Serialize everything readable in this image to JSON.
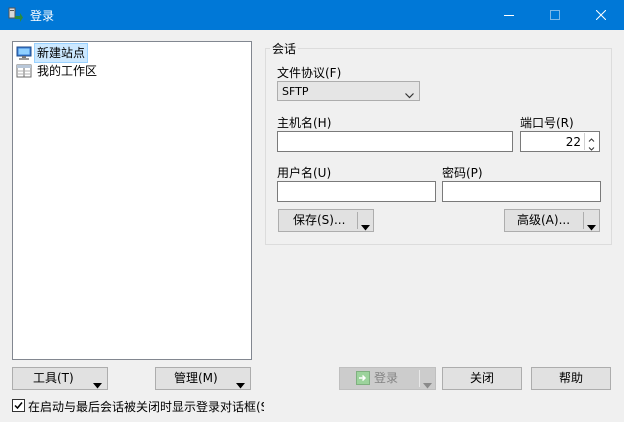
{
  "window": {
    "title": "登录",
    "app_icon": "winscp-login-icon",
    "accent": "#0078d7"
  },
  "sites": {
    "items": [
      {
        "label": "新建站点",
        "icon": "new-site-monitor-icon",
        "selected": true
      },
      {
        "label": "我的工作区",
        "icon": "workspace-icon",
        "selected": false
      }
    ]
  },
  "session": {
    "group_label": "会话",
    "protocol_label": "文件协议(F)",
    "protocol_value": "SFTP",
    "host_label": "主机名(H)",
    "host_value": "",
    "port_label": "端口号(R)",
    "port_value": "22",
    "user_label": "用户名(U)",
    "user_value": "",
    "password_label": "密码(P)",
    "password_value": "",
    "save_button": "保存(S)...",
    "advanced_button": "高级(A)..."
  },
  "footer": {
    "tools_button": "工具(T)",
    "manage_button": "管理(M)",
    "login_button": "登录",
    "close_button": "关闭",
    "help_button": "帮助",
    "show_on_startup_label": "在启动与最后会话被关闭时显示登录对话框(S)",
    "show_on_startup_checked": true
  }
}
